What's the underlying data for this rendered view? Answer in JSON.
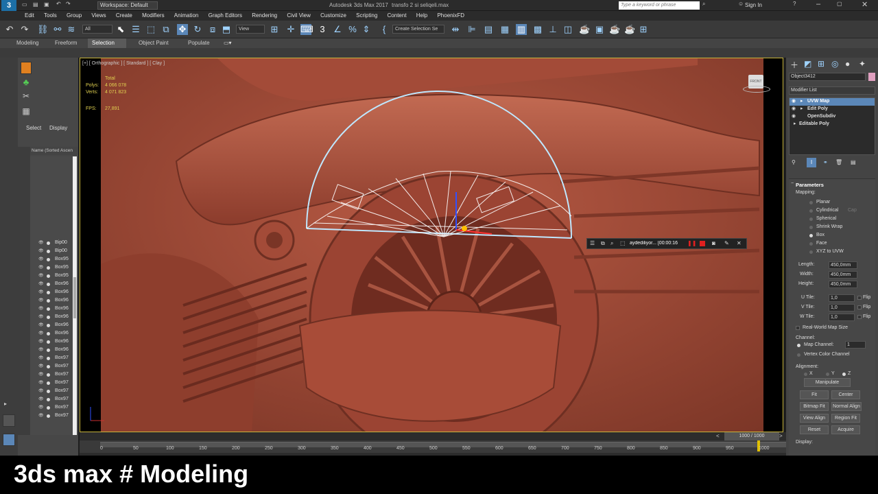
{
  "titlebar": {
    "workspace": "Workspace: Default",
    "app_title": "Autodesk 3ds Max 2017",
    "file_name": "transfo 2 si seliqeli.max",
    "search_placeholder": "Type a keyword or phrase",
    "sign_in": "Sign In"
  },
  "menu": [
    "Edit",
    "Tools",
    "Group",
    "Views",
    "Create",
    "Modifiers",
    "Animation",
    "Graph Editors",
    "Rendering",
    "Civil View",
    "Customize",
    "Scripting",
    "Content",
    "Help",
    "PhoenixFD"
  ],
  "toolbar": {
    "selection_filter": "All",
    "view_dropdown": "View",
    "selection_set": "Create Selection Se"
  },
  "ribbon": {
    "tabs": [
      "Modeling",
      "Freeform",
      "Selection",
      "Object Paint",
      "Populate"
    ],
    "active_tab": "Selection"
  },
  "scene_explorer": {
    "tab_select": "Select",
    "tab_display": "Display",
    "column_header": "Name (Sorted Ascen",
    "rows": [
      "Bip00",
      "Bip00",
      "Box95",
      "Box95",
      "Box95",
      "Box96",
      "Box96",
      "Box96",
      "Box96",
      "Box96",
      "Box96",
      "Box96",
      "Box96",
      "Box96",
      "Box97",
      "Box97",
      "Box97",
      "Box97",
      "Box97",
      "Box97",
      "Box97",
      "Box97"
    ]
  },
  "viewport": {
    "label": "[+] [ Orthographic ] [ Standard ] [ Clay ]",
    "stats_total": "Total",
    "polys_label": "Polys:",
    "polys_value": "4 066 078",
    "verts_label": "Verts:",
    "verts_value": "4 071 823",
    "fps_label": "FPS:",
    "fps_value": "27,891",
    "viewcube_label": "FRONT"
  },
  "recorder": {
    "label": "aydediliyor... [00:00:16"
  },
  "command_panel": {
    "object_name": "Object3412",
    "modifier_list": "Modifier List",
    "stack": [
      "UVW Map",
      "Edit Poly",
      "OpenSubdiv",
      "Editable Poly"
    ],
    "parameters_title": "Parameters",
    "mapping_label": "Mapping:",
    "mapping_options": [
      "Planar",
      "Cylindrical",
      "Spherical",
      "Shrink Wrap",
      "Box",
      "Face",
      "XYZ to UVW"
    ],
    "mapping_selected": "Box",
    "cap_label": "Cap",
    "length_label": "Length:",
    "length_value": "450,0mm",
    "width_label": "Width:",
    "width_value": "450,0mm",
    "height_label": "Height:",
    "height_value": "450,0mm",
    "utile_label": "U Tile:",
    "utile_value": "1,0",
    "vtile_label": "V Tile:",
    "vtile_value": "1,0",
    "wtile_label": "W Tile:",
    "wtile_value": "1,0",
    "flip_label": "Flip",
    "real_world": "Real-World Map Size",
    "channel_label": "Channel:",
    "map_channel_label": "Map Channel:",
    "map_channel_value": "1",
    "vertex_color_channel": "Vertex Color Channel",
    "alignment_label": "Alignment:",
    "axis_x": "X",
    "axis_y": "Y",
    "axis_z": "Z",
    "manipulate": "Manipulate",
    "fit": "Fit",
    "center": "Center",
    "bitmap_fit": "Bitmap Fit",
    "normal_align": "Normal Align",
    "view_align": "View Align",
    "region_fit": "Region Fit",
    "reset": "Reset",
    "acquire": "Acquire",
    "display_label": "Display:"
  },
  "timeline": {
    "frame_counter": "1000 / 1000",
    "ticks": [
      "0",
      "50",
      "100",
      "150",
      "200",
      "250",
      "300",
      "350",
      "400",
      "450",
      "500",
      "550",
      "600",
      "650",
      "700",
      "750",
      "800",
      "850",
      "900",
      "950",
      "1000"
    ]
  },
  "banner": {
    "text": "3ds max # Modeling"
  },
  "colors": {
    "clay": "#a44a38",
    "accent_blue": "#5b9bd5",
    "viewport_border": "#c8b43a",
    "banner_bg": "#000000"
  }
}
